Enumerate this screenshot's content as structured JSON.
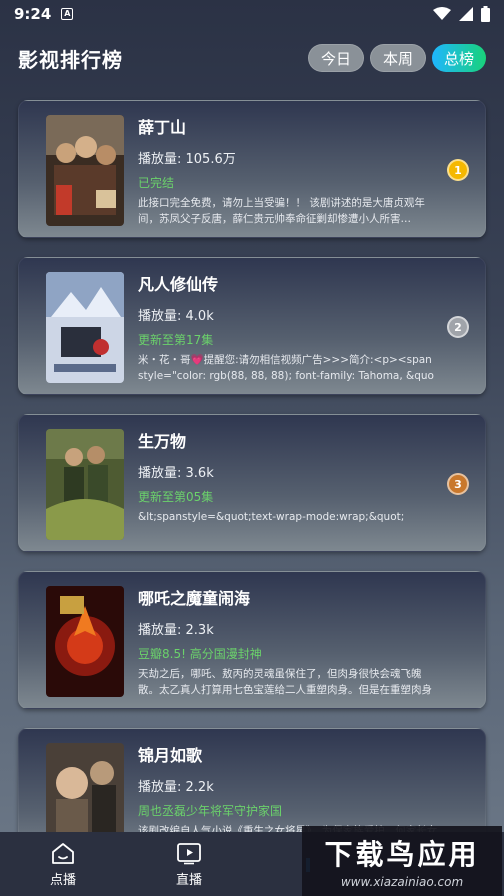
{
  "status_bar": {
    "time": "9:24",
    "notif_glyph": "A"
  },
  "header": {
    "title": "影视排行榜",
    "segments": [
      {
        "label": "今日",
        "active": false
      },
      {
        "label": "本周",
        "active": false
      },
      {
        "label": "总榜",
        "active": true
      }
    ]
  },
  "items": [
    {
      "title": "薛丁山",
      "views_label": "播放量: ",
      "views": "105.6万",
      "status": "已完结",
      "desc": "此接口完全免费，请勿上当受骗！！ 该剧讲述的是大唐贞观年间，苏凤父子反唐，薛仁贵元帅奉命征剿却惨遭小人所害…",
      "rank": "1",
      "rank_color": "#f5b800"
    },
    {
      "title": "凡人修仙传",
      "views_label": "播放量: ",
      "views": "4.0k",
      "status": "更新至第17集",
      "desc": "米・花・哥💗提醒您:请勿相信视频广告>>>简介:<p><span style=\"color: rgb(88, 88, 88); font-family: Tahoma, &quot;hir…",
      "rank": "2",
      "rank_color": "#a0a4aa"
    },
    {
      "title": "生万物",
      "views_label": "播放量: ",
      "views": "3.6k",
      "status": "更新至第05集",
      "desc": "&lt;spanstyle=&quot;text-wrap-mode:wrap;&quot;",
      "rank": "3",
      "rank_color": "#c9782c"
    },
    {
      "title": "哪吒之魔童闹海",
      "views_label": "播放量: ",
      "views": "2.3k",
      "status": "豆瓣8.5! 高分国漫封神",
      "desc": "天劫之后，哪吒、敖丙的灵魂虽保住了，但肉身很快会魂飞魄散。太乙真人打算用七色宝莲给二人重塑肉身。但是在重塑肉身的过程中…",
      "rank": "",
      "rank_color": ""
    },
    {
      "title": "锦月如歌",
      "views_label": "播放量: ",
      "views": "2.2k",
      "status": "周也丞磊少年将军守护家国",
      "desc": "该剧改编自人气小说《重生之女将星》，为保家族爱护，何家长女何…",
      "rank": "",
      "rank_color": ""
    }
  ],
  "bottom_nav": [
    {
      "label": "点播",
      "icon": "home-icon"
    },
    {
      "label": "直播",
      "icon": "tv-play-icon"
    },
    {
      "label": "",
      "icon": "partial-icon"
    }
  ],
  "watermark": {
    "big": "下载鸟应用",
    "small": "www.xiazainiao.com"
  }
}
